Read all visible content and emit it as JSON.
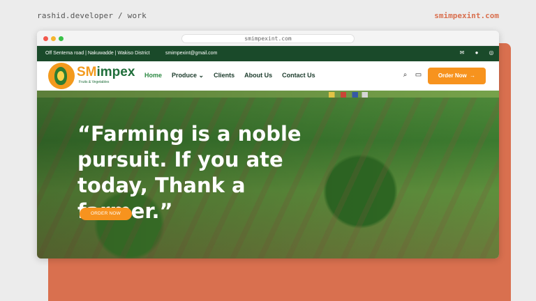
{
  "header": {
    "left": "rashid.developer / work",
    "right": "smimpexint.com"
  },
  "browser": {
    "url": "smimpexint.com"
  },
  "topbar": {
    "address": "Off Sentema road | Nakuwadde | Wakiso District",
    "email": "smimpexint@gmail.com",
    "icons": [
      "email-icon",
      "facebook-icon",
      "instagram-icon"
    ]
  },
  "brand": {
    "sm": "SM",
    "impex": "impex",
    "tagline": "Fruits & Vegetables",
    "colors": {
      "primary_green": "#1f6e3a",
      "accent_orange": "#f7931e"
    }
  },
  "nav": {
    "items": [
      "Home",
      "Produce",
      "Clients",
      "About Us",
      "Contact Us"
    ],
    "produce_caret": "⌄",
    "search_icon": "search-icon",
    "chat_icon": "chat-icon",
    "order_button": "Order Now",
    "order_arrow": "→"
  },
  "hero": {
    "quote": "“Farming is a noble pursuit. If you ate today, Thank a farmer.”",
    "button": "ORDER NOW"
  }
}
